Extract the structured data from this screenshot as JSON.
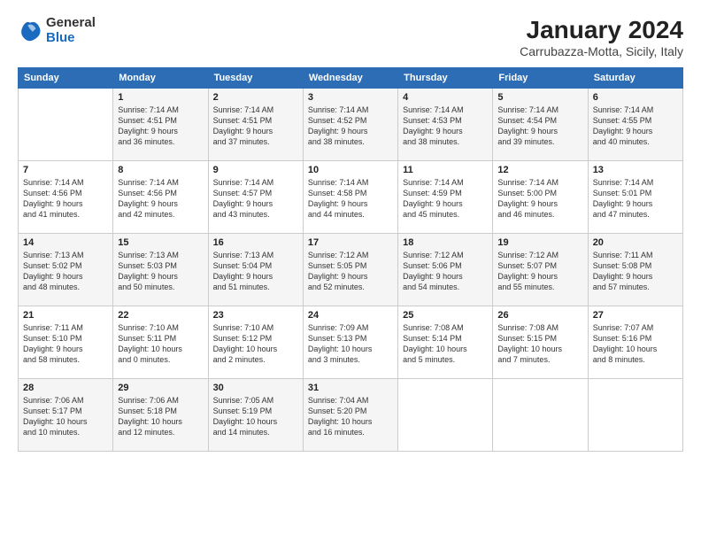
{
  "logo": {
    "general": "General",
    "blue": "Blue"
  },
  "title": "January 2024",
  "subtitle": "Carrubazza-Motta, Sicily, Italy",
  "weekdays": [
    "Sunday",
    "Monday",
    "Tuesday",
    "Wednesday",
    "Thursday",
    "Friday",
    "Saturday"
  ],
  "weeks": [
    [
      {
        "day": "",
        "info": ""
      },
      {
        "day": "1",
        "info": "Sunrise: 7:14 AM\nSunset: 4:51 PM\nDaylight: 9 hours\nand 36 minutes."
      },
      {
        "day": "2",
        "info": "Sunrise: 7:14 AM\nSunset: 4:51 PM\nDaylight: 9 hours\nand 37 minutes."
      },
      {
        "day": "3",
        "info": "Sunrise: 7:14 AM\nSunset: 4:52 PM\nDaylight: 9 hours\nand 38 minutes."
      },
      {
        "day": "4",
        "info": "Sunrise: 7:14 AM\nSunset: 4:53 PM\nDaylight: 9 hours\nand 38 minutes."
      },
      {
        "day": "5",
        "info": "Sunrise: 7:14 AM\nSunset: 4:54 PM\nDaylight: 9 hours\nand 39 minutes."
      },
      {
        "day": "6",
        "info": "Sunrise: 7:14 AM\nSunset: 4:55 PM\nDaylight: 9 hours\nand 40 minutes."
      }
    ],
    [
      {
        "day": "7",
        "info": "Sunrise: 7:14 AM\nSunset: 4:56 PM\nDaylight: 9 hours\nand 41 minutes."
      },
      {
        "day": "8",
        "info": "Sunrise: 7:14 AM\nSunset: 4:56 PM\nDaylight: 9 hours\nand 42 minutes."
      },
      {
        "day": "9",
        "info": "Sunrise: 7:14 AM\nSunset: 4:57 PM\nDaylight: 9 hours\nand 43 minutes."
      },
      {
        "day": "10",
        "info": "Sunrise: 7:14 AM\nSunset: 4:58 PM\nDaylight: 9 hours\nand 44 minutes."
      },
      {
        "day": "11",
        "info": "Sunrise: 7:14 AM\nSunset: 4:59 PM\nDaylight: 9 hours\nand 45 minutes."
      },
      {
        "day": "12",
        "info": "Sunrise: 7:14 AM\nSunset: 5:00 PM\nDaylight: 9 hours\nand 46 minutes."
      },
      {
        "day": "13",
        "info": "Sunrise: 7:14 AM\nSunset: 5:01 PM\nDaylight: 9 hours\nand 47 minutes."
      }
    ],
    [
      {
        "day": "14",
        "info": "Sunrise: 7:13 AM\nSunset: 5:02 PM\nDaylight: 9 hours\nand 48 minutes."
      },
      {
        "day": "15",
        "info": "Sunrise: 7:13 AM\nSunset: 5:03 PM\nDaylight: 9 hours\nand 50 minutes."
      },
      {
        "day": "16",
        "info": "Sunrise: 7:13 AM\nSunset: 5:04 PM\nDaylight: 9 hours\nand 51 minutes."
      },
      {
        "day": "17",
        "info": "Sunrise: 7:12 AM\nSunset: 5:05 PM\nDaylight: 9 hours\nand 52 minutes."
      },
      {
        "day": "18",
        "info": "Sunrise: 7:12 AM\nSunset: 5:06 PM\nDaylight: 9 hours\nand 54 minutes."
      },
      {
        "day": "19",
        "info": "Sunrise: 7:12 AM\nSunset: 5:07 PM\nDaylight: 9 hours\nand 55 minutes."
      },
      {
        "day": "20",
        "info": "Sunrise: 7:11 AM\nSunset: 5:08 PM\nDaylight: 9 hours\nand 57 minutes."
      }
    ],
    [
      {
        "day": "21",
        "info": "Sunrise: 7:11 AM\nSunset: 5:10 PM\nDaylight: 9 hours\nand 58 minutes."
      },
      {
        "day": "22",
        "info": "Sunrise: 7:10 AM\nSunset: 5:11 PM\nDaylight: 10 hours\nand 0 minutes."
      },
      {
        "day": "23",
        "info": "Sunrise: 7:10 AM\nSunset: 5:12 PM\nDaylight: 10 hours\nand 2 minutes."
      },
      {
        "day": "24",
        "info": "Sunrise: 7:09 AM\nSunset: 5:13 PM\nDaylight: 10 hours\nand 3 minutes."
      },
      {
        "day": "25",
        "info": "Sunrise: 7:08 AM\nSunset: 5:14 PM\nDaylight: 10 hours\nand 5 minutes."
      },
      {
        "day": "26",
        "info": "Sunrise: 7:08 AM\nSunset: 5:15 PM\nDaylight: 10 hours\nand 7 minutes."
      },
      {
        "day": "27",
        "info": "Sunrise: 7:07 AM\nSunset: 5:16 PM\nDaylight: 10 hours\nand 8 minutes."
      }
    ],
    [
      {
        "day": "28",
        "info": "Sunrise: 7:06 AM\nSunset: 5:17 PM\nDaylight: 10 hours\nand 10 minutes."
      },
      {
        "day": "29",
        "info": "Sunrise: 7:06 AM\nSunset: 5:18 PM\nDaylight: 10 hours\nand 12 minutes."
      },
      {
        "day": "30",
        "info": "Sunrise: 7:05 AM\nSunset: 5:19 PM\nDaylight: 10 hours\nand 14 minutes."
      },
      {
        "day": "31",
        "info": "Sunrise: 7:04 AM\nSunset: 5:20 PM\nDaylight: 10 hours\nand 16 minutes."
      },
      {
        "day": "",
        "info": ""
      },
      {
        "day": "",
        "info": ""
      },
      {
        "day": "",
        "info": ""
      }
    ]
  ]
}
